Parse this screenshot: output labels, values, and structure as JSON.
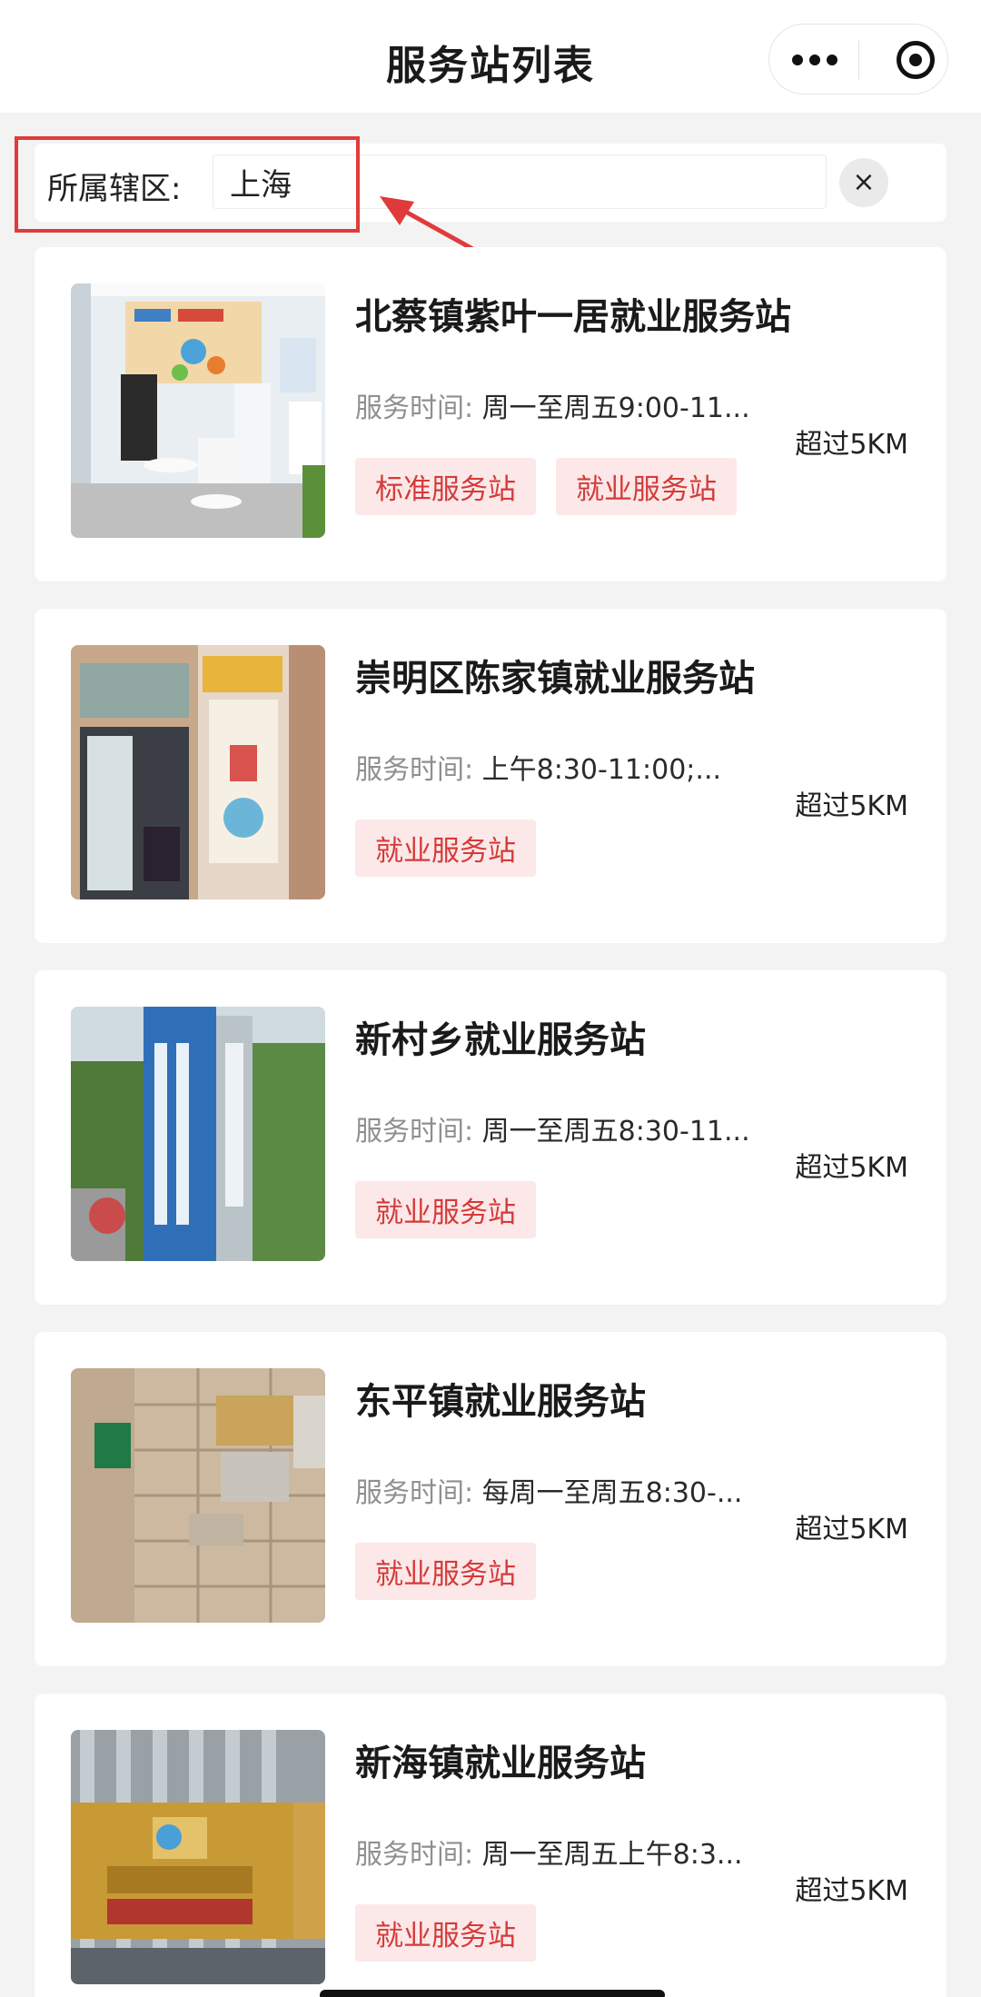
{
  "nav": {
    "title": "服务站列表",
    "more_icon": "more-dots-icon",
    "close_icon": "target-icon"
  },
  "filter": {
    "label": "所属辖区:",
    "value": "上海",
    "clear_label": "×",
    "highlight_color": "#e03b3b"
  },
  "colors": {
    "tag_bg": "#fce8e8",
    "tag_text": "#d53a3a",
    "page_bg": "#f3f3f3"
  },
  "stations": [
    {
      "title": "北蔡镇紫叶一居就业服务站",
      "hours_label": "服务时间:",
      "hours_value": "周一至周五9:00-11...",
      "tags": [
        "标准服务站",
        "就业服务站"
      ],
      "distance": "超过5KM"
    },
    {
      "title": "崇明区陈家镇就业服务站",
      "hours_label": "服务时间:",
      "hours_value": "上午8:30-11:00;...",
      "tags": [
        "就业服务站"
      ],
      "distance": "超过5KM"
    },
    {
      "title": "新村乡就业服务站",
      "hours_label": "服务时间:",
      "hours_value": "周一至周五8:30-11...",
      "tags": [
        "就业服务站"
      ],
      "distance": "超过5KM"
    },
    {
      "title": "东平镇就业服务站",
      "hours_label": "服务时间:",
      "hours_value": "每周一至周五8:30-...",
      "tags": [
        "就业服务站"
      ],
      "distance": "超过5KM"
    },
    {
      "title": "新海镇就业服务站",
      "hours_label": "服务时间:",
      "hours_value": "周一至周五上午8:3...",
      "tags": [
        "就业服务站"
      ],
      "distance": "超过5KM"
    }
  ]
}
